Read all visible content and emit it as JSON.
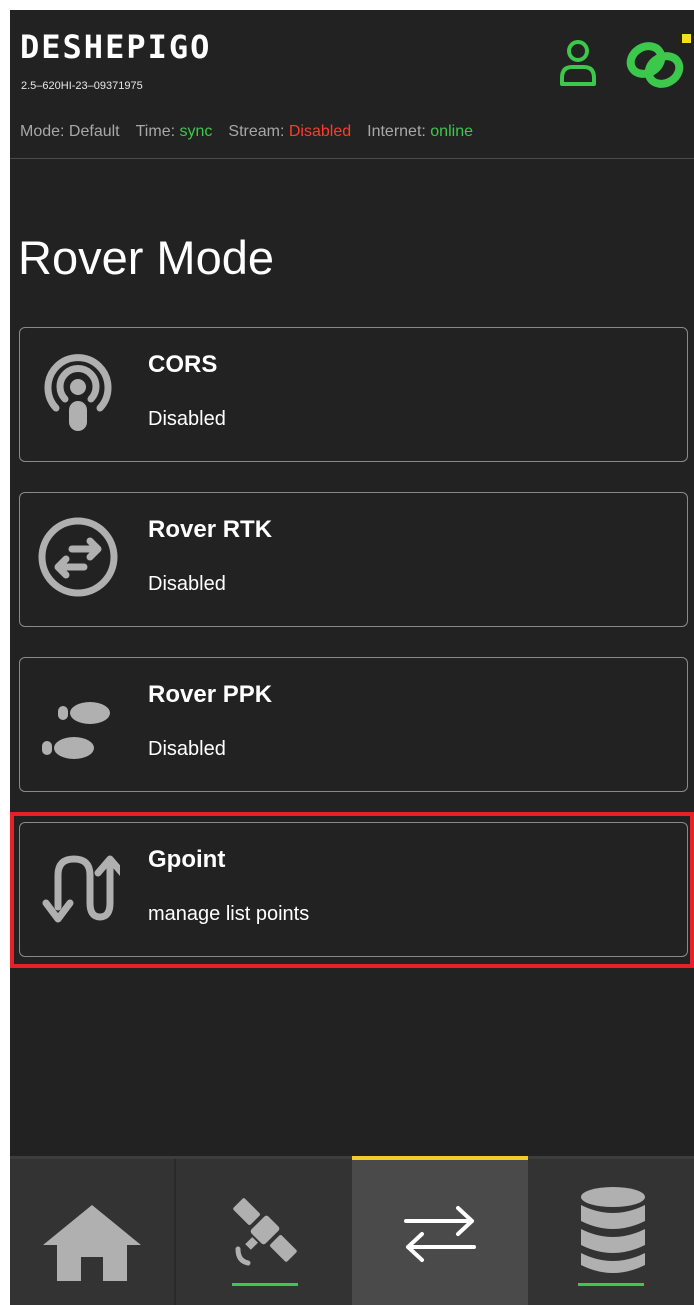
{
  "header": {
    "logo": "DESHEPIGO",
    "serial": "2.5–620HI-23–09371975",
    "status": {
      "mode_label": "Mode:",
      "mode_value": "Default",
      "time_label": "Time:",
      "time_value": "sync",
      "stream_label": "Stream:",
      "stream_value": "Disabled",
      "internet_label": "Internet:",
      "internet_value": "online"
    },
    "icons": {
      "user": "user-icon",
      "link": "link-icon"
    }
  },
  "page_title": "Rover Mode",
  "cards": [
    {
      "title": "CORS",
      "subtitle": "Disabled",
      "icon": "broadcast-icon"
    },
    {
      "title": "Rover RTK",
      "subtitle": "Disabled",
      "icon": "swap-circle-icon"
    },
    {
      "title": "Rover PPK",
      "subtitle": "Disabled",
      "icon": "footprints-icon"
    },
    {
      "title": "Gpoint",
      "subtitle": "manage list points",
      "icon": "u-turn-arrows-icon",
      "highlighted": true
    }
  ],
  "bottom_nav": [
    {
      "name": "home",
      "icon": "home-icon",
      "active": false,
      "indicator": false
    },
    {
      "name": "satellite",
      "icon": "satellite-icon",
      "active": false,
      "indicator": true
    },
    {
      "name": "modes",
      "icon": "swap-arrows-icon",
      "active": true,
      "indicator": false
    },
    {
      "name": "database",
      "icon": "database-icon",
      "active": false,
      "indicator": true
    }
  ],
  "colors": {
    "background": "#222222",
    "accent_green": "#3cc84a",
    "accent_red": "#ff3b30",
    "active_tab_indicator": "#f0cc2e",
    "highlight_border": "#e8202a",
    "icon_gray": "#b0b0b0"
  }
}
